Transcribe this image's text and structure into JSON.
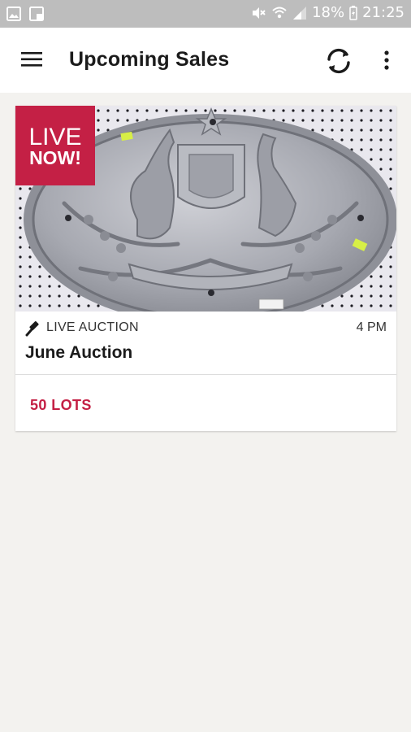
{
  "status_bar": {
    "battery": "18%",
    "time": "21:25",
    "icons": [
      "image-icon",
      "screenshot-icon",
      "mute-icon",
      "wifi-icon",
      "signal-icon",
      "battery-charging-icon"
    ]
  },
  "app_bar": {
    "title": "Upcoming Sales",
    "icons": [
      "menu-icon",
      "refresh-icon",
      "more-vert-icon"
    ]
  },
  "sales": [
    {
      "badge_line1": "LIVE",
      "badge_line2": "NOW!",
      "type": "LIVE AUCTION",
      "time": "4 PM",
      "title": "June Auction",
      "lots": "50 LOTS"
    }
  ],
  "colors": {
    "accent": "#c42045",
    "status_bar": "#bdbdbd",
    "background": "#f3f2ef"
  }
}
